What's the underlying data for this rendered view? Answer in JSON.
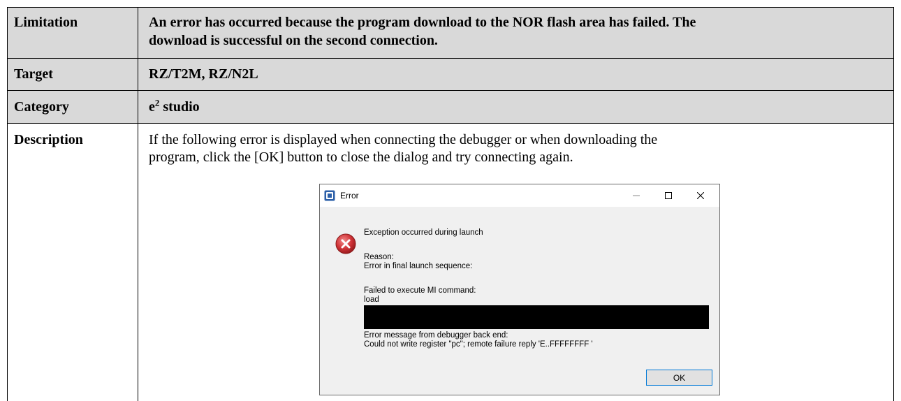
{
  "table": {
    "limitation_label": "Limitation",
    "limitation_line1": "An error has occurred because the program download to the NOR flash area has failed. The",
    "limitation_line2": "download is successful on the second connection.",
    "target_label": "Target",
    "target_value": "RZ/T2M, RZ/N2L",
    "category_label": "Category",
    "category_value_base": "e",
    "category_value_sup": "2",
    "category_value_rest": " studio",
    "description_label": "Description",
    "description_line1": "If the following error is displayed when connecting the debugger or when downloading the",
    "description_line2": "program, click the [OK] button to close the dialog and try connecting again."
  },
  "dialog": {
    "title": "Error",
    "minimize_icon": "minimize-icon",
    "maximize_icon": "maximize-icon",
    "close_icon": "close-icon",
    "error_icon": "error-icon",
    "message_heading": "Exception occurred during launch",
    "reason_label": "Reason:",
    "reason_text": "Error in final launch sequence:",
    "failed_text": "Failed to execute MI command:",
    "command": "load",
    "backend_label": "Error message from debugger back end:",
    "backend_message": "Could not write register \"pc\"; remote failure reply 'E..FFFFFFFF '",
    "ok_label": "OK"
  },
  "colors": {
    "header_row_bg": "#d9d9d9",
    "ok_border": "#0078d7",
    "error_icon_red": "#d13438"
  }
}
